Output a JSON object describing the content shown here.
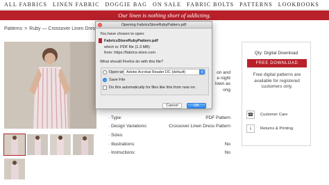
{
  "nav": {
    "items": [
      "ALL FABRICS",
      "LINEN FABRIC",
      "DOGGIE BAG",
      "ON SALE",
      "FABRIC BOLTS",
      "PATTERNS",
      "LOOKBOOKS"
    ]
  },
  "tagline": "Our linen is nothing short of addicting.",
  "breadcrumb": {
    "items": [
      "Patterns",
      "Ruby — Crossover Linen Dress Pat"
    ]
  },
  "description_fragments": [
    "on and",
    "e night",
    "lown as",
    "ong"
  ],
  "specs": [
    {
      "key": "Type:",
      "value": "PDF Pattern"
    },
    {
      "key": "Design Variations:",
      "value": "Crossover Linen Dress Pattern"
    },
    {
      "key": "Sizes:",
      "value": ""
    },
    {
      "key": "Illustrations:",
      "value": "No"
    },
    {
      "key": "Instructions:",
      "value": "No"
    }
  ],
  "sidebar": {
    "qty": "Qty: Digital Download",
    "button": "FREE DOWNLOAD",
    "note": "Free digital patterns are available for registered customers only.",
    "customer_care": "Customer Care",
    "returns": "Returns & Printing",
    "phone_icon": "phone-icon",
    "info_icon": "info-icon"
  },
  "dialog": {
    "title": "Opening FabricsStoreRubyPattern.pdf",
    "intro": "You have chosen to open:",
    "filename": "FabricsStoreRubyPattern.pdf",
    "which_is": "which is:  PDF file (1.3 MB)",
    "from": "from:  https://fabrics-store.com",
    "question": "What should Firefox do with this file?",
    "open_with_label": "Open with",
    "open_with_app": "Adobe Acrobat Reader DC (default)",
    "save_file_label": "Save File",
    "auto_label": "Do this automatically for files like this from now on.",
    "cancel_label": "Cancel",
    "ok_label": "OK",
    "selected_option": "Save File"
  },
  "colors": {
    "accent": "#b8202a",
    "dialog_button": "#2a84f0"
  }
}
